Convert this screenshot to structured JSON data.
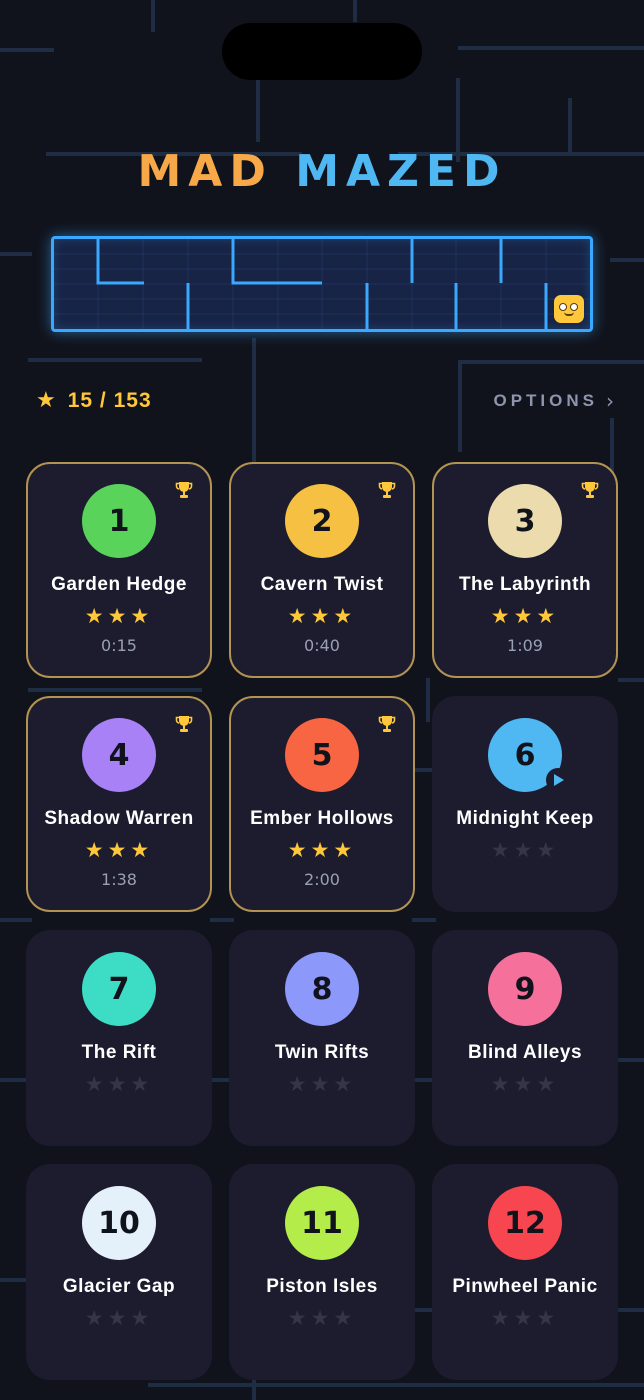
{
  "app": {
    "title_word1": "MAD",
    "title_word2": "MAZED"
  },
  "header": {
    "stars_progress": "15 / 153",
    "star_icon": "star-icon",
    "options_label": "OPTIONS",
    "options_icon": "chevron-right-icon"
  },
  "colors": {
    "accent_orange": "#f7a94a",
    "accent_blue": "#4fb8f2",
    "gold": "#ffc83a",
    "card_bg": "#1c1c2e",
    "completed_border": "#b29351"
  },
  "levels": [
    {
      "number": "1",
      "name": "Garden Hedge",
      "stars": 3,
      "time": "0:15",
      "color": "#5ad35a",
      "completed": true
    },
    {
      "number": "2",
      "name": "Cavern Twist",
      "stars": 3,
      "time": "0:40",
      "color": "#f6c142",
      "completed": true
    },
    {
      "number": "3",
      "name": "The Labyrinth",
      "stars": 3,
      "time": "1:09",
      "color": "#ecdcad",
      "completed": true
    },
    {
      "number": "4",
      "name": "Shadow Warren",
      "stars": 3,
      "time": "1:38",
      "color": "#a781f5",
      "completed": true
    },
    {
      "number": "5",
      "name": "Ember Hollows",
      "stars": 3,
      "time": "2:00",
      "color": "#f76542",
      "completed": true
    },
    {
      "number": "6",
      "name": "Midnight Keep",
      "stars": 0,
      "time": "",
      "color": "#4fb8f2",
      "completed": false,
      "current": true
    },
    {
      "number": "7",
      "name": "The Rift",
      "stars": 0,
      "time": "",
      "color": "#3ddcc4",
      "completed": false
    },
    {
      "number": "8",
      "name": "Twin Rifts",
      "stars": 0,
      "time": "",
      "color": "#8c98fa",
      "completed": false
    },
    {
      "number": "9",
      "name": "Blind Alleys",
      "stars": 0,
      "time": "",
      "color": "#f5709a",
      "completed": false
    },
    {
      "number": "10",
      "name": "Glacier Gap",
      "stars": 0,
      "time": "",
      "color": "#e4f1fa",
      "completed": false
    },
    {
      "number": "11",
      "name": "Piston Isles",
      "stars": 0,
      "time": "",
      "color": "#b4ec4a",
      "completed": false
    },
    {
      "number": "12",
      "name": "Pinwheel Panic",
      "stars": 0,
      "time": "",
      "color": "#f7464f",
      "completed": false
    }
  ]
}
